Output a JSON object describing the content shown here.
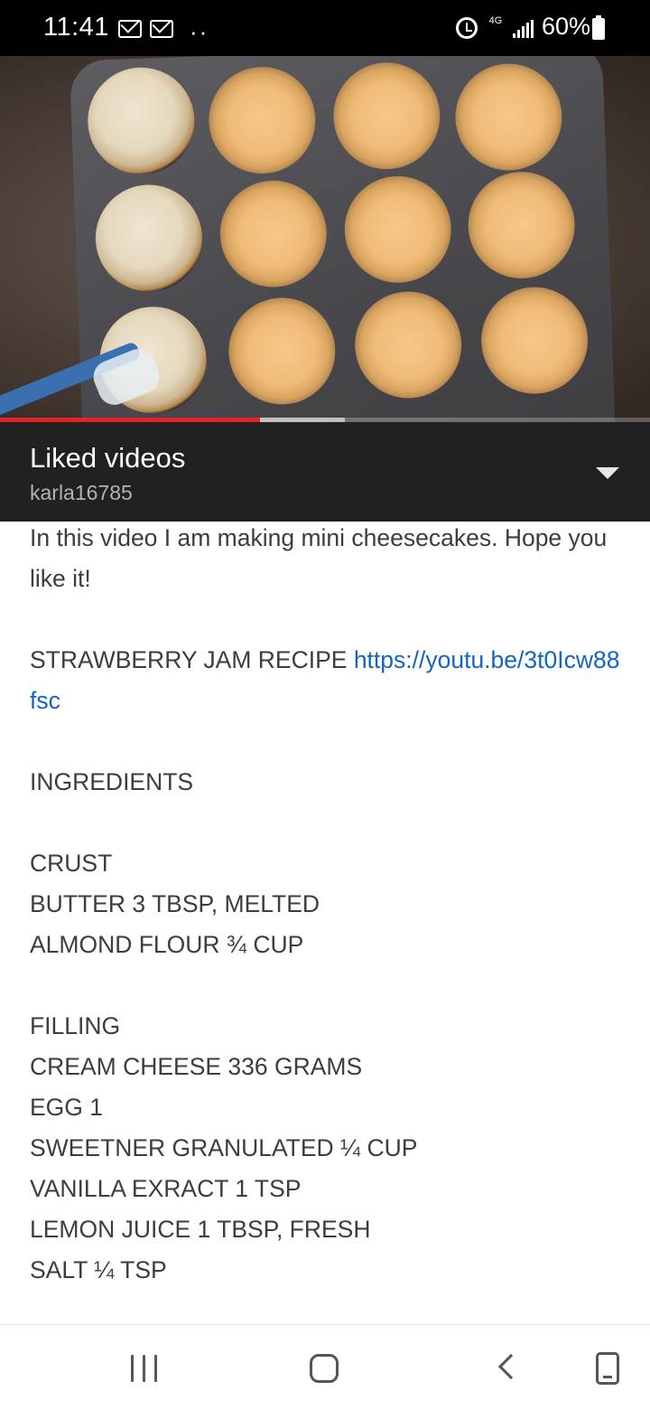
{
  "status_bar": {
    "time": "11:41",
    "dots": "··",
    "network_label": "4G",
    "battery": "60%"
  },
  "video": {
    "progress_played": 0.4,
    "progress_buffered": 0.53
  },
  "playlist": {
    "title": "Liked videos",
    "owner": "karla16785"
  },
  "description": {
    "intro": "In this video I am making mini cheesecakes. Hope you like it!",
    "jam_label": "STRAWBERRY JAM RECIPE ",
    "jam_link": "https://youtu.be/3t0Icw88fsc",
    "ingredients_heading": "INGREDIENTS",
    "crust_heading": "CRUST",
    "crust_items": [
      "BUTTER 3 TBSP, MELTED",
      "ALMOND FLOUR ¾ CUP"
    ],
    "filling_heading": "FILLING",
    "filling_items": [
      "CREAM CHEESE 336 GRAMS",
      "EGG 1",
      "SWEETNER GRANULATED ¼ CUP",
      "VANILLA EXRACT 1 TSP",
      "LEMON JUICE 1 TBSP, FRESH",
      "SALT ¼ TSP"
    ]
  },
  "colors": {
    "link": "#1565c0",
    "progress": "#e52128",
    "playlist_bg": "#212121"
  }
}
